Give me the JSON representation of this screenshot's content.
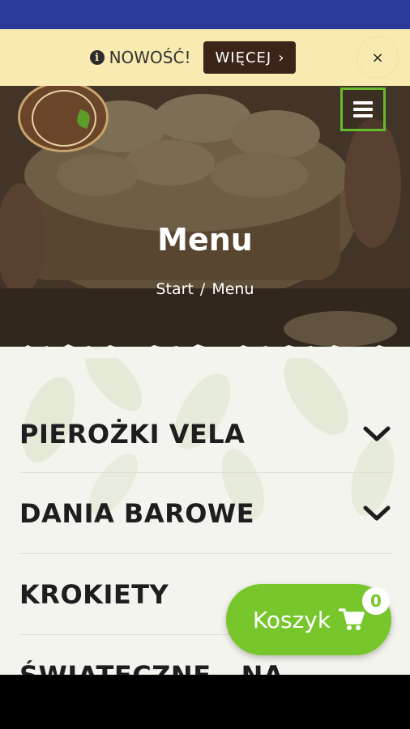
{
  "promo": {
    "info_text": "NOWOŚĆ!",
    "button_label": "WIĘCEJ",
    "button_arrow": "›",
    "close_label": "×"
  },
  "hero": {
    "title": "Menu",
    "breadcrumb": {
      "home": "Start",
      "separator": "/",
      "current": "Menu"
    }
  },
  "categories": [
    {
      "label": "PIEROŻKI VELA",
      "expandable": true
    },
    {
      "label": "DANIA BAROWE",
      "expandable": true
    },
    {
      "label": "KROKIETY",
      "expandable": false
    },
    {
      "label": "ŚWIĄTECZNE - NA",
      "expandable": false
    }
  ],
  "cart": {
    "label": "Koszyk",
    "count": "0"
  },
  "colors": {
    "status_bar": "#2a3a9b",
    "promo_bg": "#f8eab0",
    "promo_button": "#3b2418",
    "accent_green": "#77c62c",
    "content_bg": "#f4f4ee"
  },
  "icons": {
    "info": "info-icon",
    "menu": "hamburger-menu-icon",
    "chevron": "chevron-down-icon",
    "cart": "shopping-cart-icon",
    "close": "close-icon"
  }
}
